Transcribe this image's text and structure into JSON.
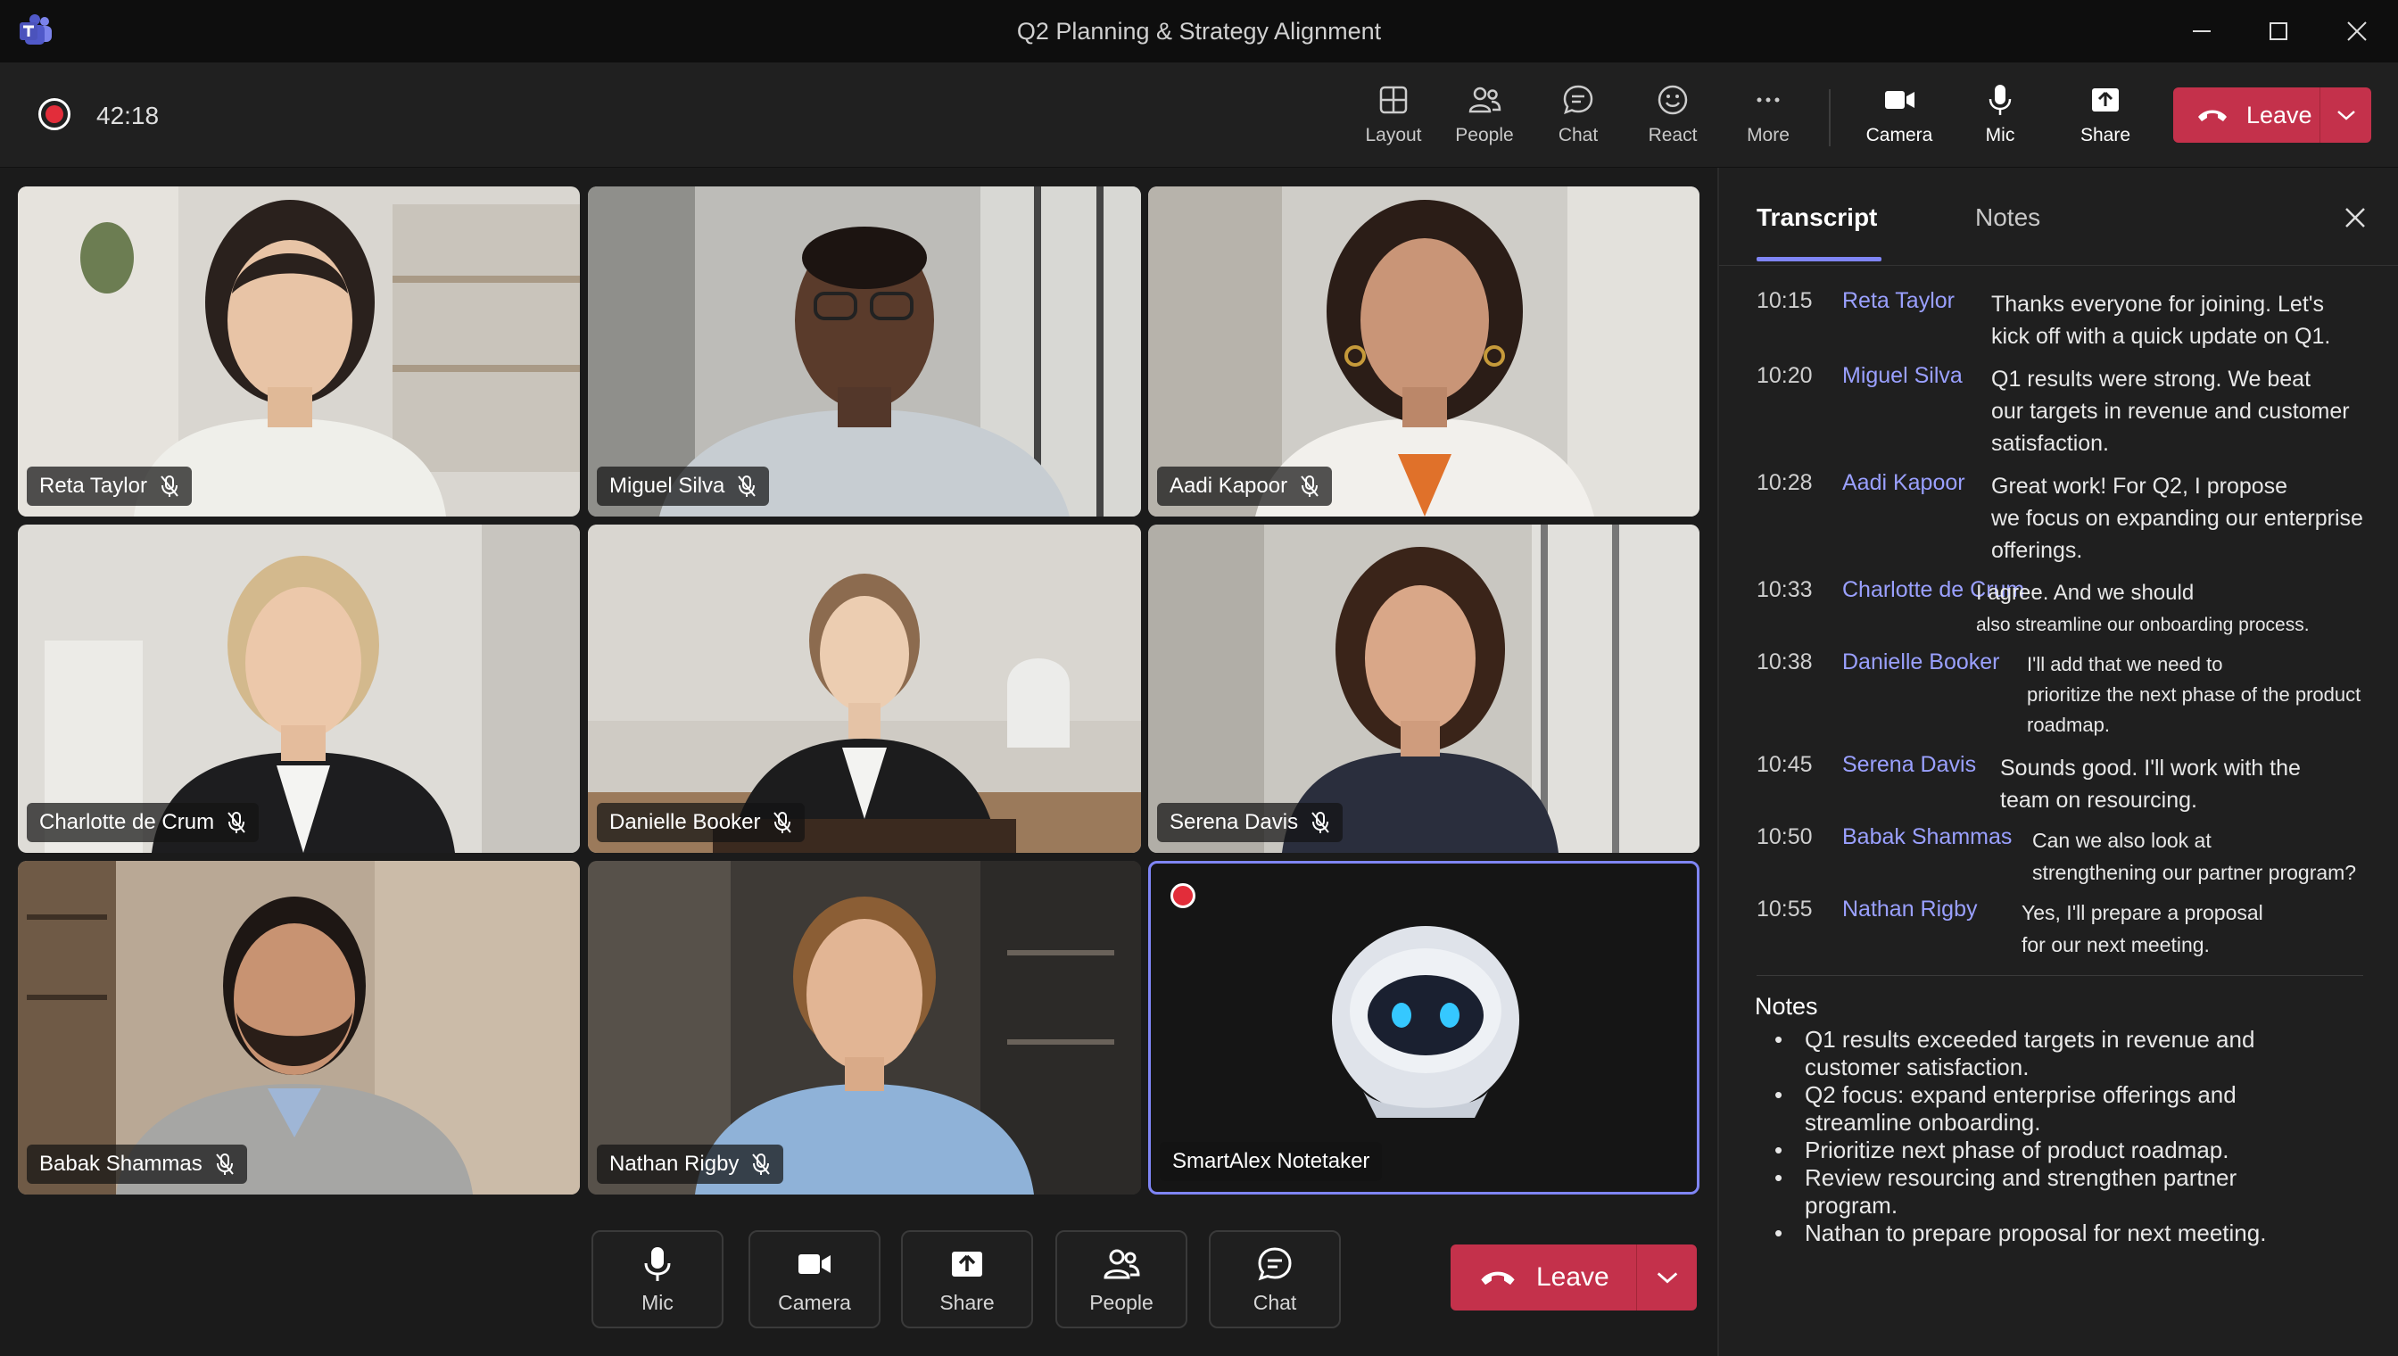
{
  "window": {
    "title": "Q2 Planning & Strategy Alignment"
  },
  "meeting": {
    "elapsed": "42:18"
  },
  "toolbar": {
    "layout": "Layout",
    "people": "People",
    "chat": "Chat",
    "react": "React",
    "more": "More",
    "camera": "Camera",
    "mic": "Mic",
    "share": "Share",
    "leave": "Leave"
  },
  "participants": [
    {
      "name": "Reta Taylor",
      "muted": true
    },
    {
      "name": "Miguel Silva",
      "muted": true
    },
    {
      "name": "Aadi Kapoor",
      "muted": true
    },
    {
      "name": "Charlotte de Crum",
      "muted": true
    },
    {
      "name": "Danielle Booker",
      "muted": true
    },
    {
      "name": "Serena Davis",
      "muted": true
    },
    {
      "name": "Babak Shammas",
      "muted": true
    },
    {
      "name": "Nathan Rigby",
      "muted": true
    },
    {
      "name": "SmartAlex Notetaker",
      "muted": false,
      "recording": true
    }
  ],
  "bottom_bar": {
    "mic": "Mic",
    "camera": "Camera",
    "share": "Share",
    "people": "People",
    "chat": "Chat",
    "leave": "Leave"
  },
  "panel": {
    "tabs": [
      "Transcript",
      "Notes"
    ],
    "transcript": [
      {
        "time": "10:15",
        "speaker": "Reta Taylor",
        "lines": [
          "Thanks everyone for joining. Let's",
          "kick off with a quick update on Q1."
        ]
      },
      {
        "time": "10:20",
        "speaker": "Miguel Silva",
        "lines": [
          "Q1 results were strong. We beat",
          "our targets in revenue and customer",
          "satisfaction."
        ]
      },
      {
        "time": "10:28",
        "speaker": "Aadi Kapoor",
        "lines": [
          "Great work! For Q2, I propose",
          "we focus on expanding our enterprise",
          "offerings."
        ]
      },
      {
        "time": "10:33",
        "speaker": "Charlotte de Crum",
        "lines": [
          "I agree. And we should",
          "also streamline our onboarding process."
        ]
      },
      {
        "time": "10:38",
        "speaker": "Danielle Booker",
        "lines": [
          "I'll add that we need to",
          "prioritize the next phase of the product",
          "roadmap."
        ]
      },
      {
        "time": "10:45",
        "speaker": "Serena Davis",
        "lines": [
          "Sounds good. I'll work with the",
          "team on resourcing."
        ]
      },
      {
        "time": "10:50",
        "speaker": "Babak Shammas",
        "lines": [
          "Can we also look at",
          "strengthening our partner program?"
        ]
      },
      {
        "time": "10:55",
        "speaker": "Nathan Rigby",
        "lines": [
          "Yes, I'll prepare a proposal",
          "for our next meeting."
        ]
      }
    ],
    "notes_title": "Notes",
    "notes": [
      "Q1 results exceeded targets in revenue and customer satisfaction.",
      "Q2 focus: expand enterprise offerings and streamline onboarding.",
      "Prioritize next phase of product roadmap.",
      "Review resourcing and strengthen partner program.",
      "Nathan to prepare proposal for next meeting."
    ]
  },
  "colors": {
    "leave": "#c4314b",
    "accent": "#7f85f5",
    "recording": "#e22d3a"
  }
}
